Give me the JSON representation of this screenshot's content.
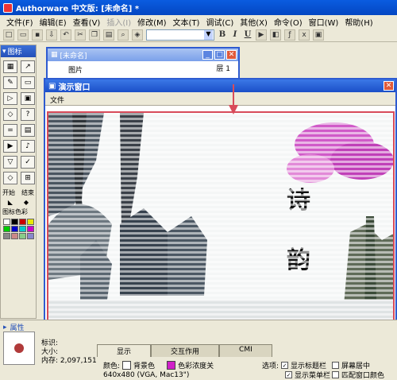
{
  "app": {
    "title": "Authorware 中文版: [未命名] *"
  },
  "menu": [
    "文件(F)",
    "编辑(E)",
    "查看(V)",
    "插入(I)",
    "修改(M)",
    "文本(T)",
    "调试(C)",
    "其他(X)",
    "命令(O)",
    "窗口(W)",
    "帮助(H)"
  ],
  "toolbar": {
    "bold": "B",
    "italic": "I",
    "underline": "U"
  },
  "palette": {
    "title": "图标",
    "start_label": "开始",
    "end_label": "结束",
    "color_label": "图标色彩"
  },
  "flowwin": {
    "title": "[未命名]",
    "layer": "层 1",
    "map_item": "图片"
  },
  "presw": {
    "title": "演示窗口",
    "menu_file": "文件"
  },
  "props": {
    "title": "属性",
    "info_id": "标识:",
    "info_size": "大小:",
    "info_mem": "内存: 2,097,151",
    "tabs": [
      "显示",
      "交互作用",
      "CMI"
    ],
    "color_label": "颜色:",
    "bg_color_label": "背景色",
    "chroma_label": "色彩浓度关",
    "options_label": "选项:",
    "opt1": "显示标题栏",
    "opt2": "显示菜单栏",
    "opt3": "屏幕居中",
    "opt4": "匹配窗口颜色",
    "size_value": "640x480 (VGA, Mac13\")"
  },
  "colors": {
    "chroma": "#d020c8",
    "accent": "#d84b5a"
  }
}
